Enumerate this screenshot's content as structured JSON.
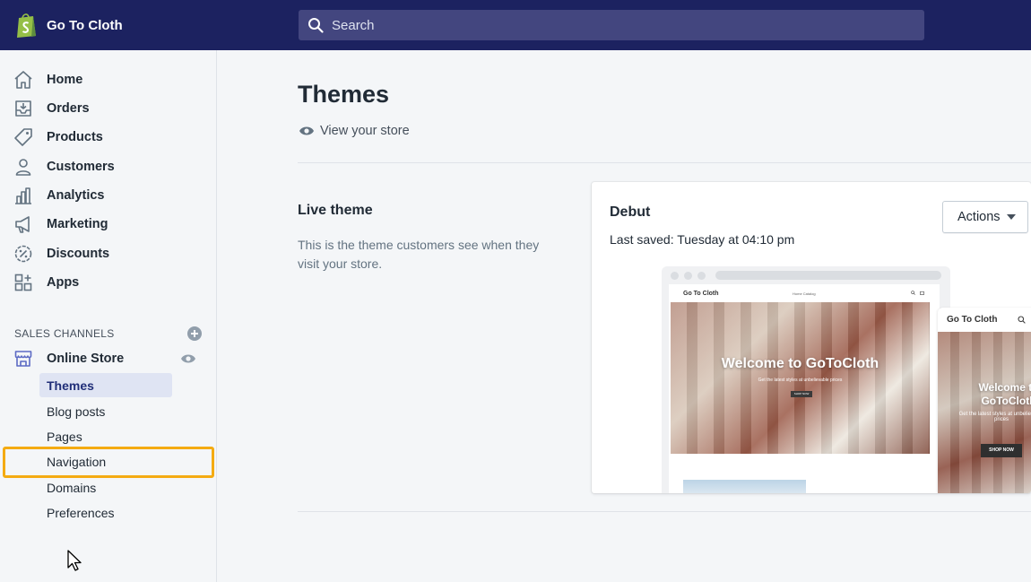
{
  "brand": {
    "name": "Go To Cloth",
    "logo": "shopify-bag-icon",
    "logo_color": "#95bf47"
  },
  "search": {
    "placeholder": "Search"
  },
  "colors": {
    "topbar": "#1c2260",
    "active_bg": "#dfe4f3",
    "active_text": "#202e78",
    "highlight": "#f4ab12"
  },
  "sidebar": {
    "items": [
      {
        "label": "Home",
        "icon": "home-icon"
      },
      {
        "label": "Orders",
        "icon": "orders-icon"
      },
      {
        "label": "Products",
        "icon": "tag-icon"
      },
      {
        "label": "Customers",
        "icon": "person-icon"
      },
      {
        "label": "Analytics",
        "icon": "bar-chart-icon"
      },
      {
        "label": "Marketing",
        "icon": "megaphone-icon"
      },
      {
        "label": "Discounts",
        "icon": "discount-icon"
      },
      {
        "label": "Apps",
        "icon": "apps-icon"
      }
    ],
    "sales_channels": {
      "heading": "SALES CHANNELS",
      "channel": {
        "label": "Online Store",
        "icon": "store-icon"
      },
      "subitems": [
        {
          "label": "Themes",
          "active": true
        },
        {
          "label": "Blog posts"
        },
        {
          "label": "Pages"
        },
        {
          "label": "Navigation",
          "highlighted": true
        },
        {
          "label": "Domains"
        },
        {
          "label": "Preferences"
        }
      ]
    }
  },
  "main": {
    "title": "Themes",
    "view_store": "View your store",
    "live_theme": {
      "heading": "Live theme",
      "description": "This is the theme customers see when they visit your store."
    },
    "theme": {
      "name": "Debut",
      "last_saved": "Last saved: Tuesday at 04:10 pm",
      "actions_label": "Actions",
      "desktop_preview": {
        "logo": "Go To Cloth",
        "nav": "Home   Catalog",
        "hero_title": "Welcome to GoToCloth",
        "hero_subtitle": "Get the latest styles at unbelievable prices",
        "hero_button": "SHOP NOW"
      },
      "mobile_preview": {
        "logo": "Go To Cloth",
        "hero_title": "Welcome to GoToCloth",
        "hero_subtitle": "Get the latest styles at unbelievable prices",
        "hero_button": "SHOP NOW"
      }
    }
  }
}
